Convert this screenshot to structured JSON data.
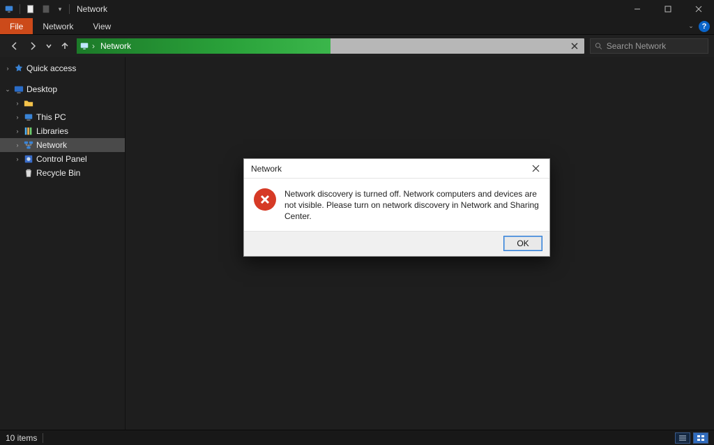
{
  "window": {
    "title": "Network"
  },
  "ribbon": {
    "file": "File",
    "tabs": [
      "Network",
      "View"
    ],
    "help": "?"
  },
  "nav": {
    "breadcrumb": "Network",
    "search_placeholder": "Search Network"
  },
  "sidebar": {
    "quick_access": "Quick access",
    "desktop": "Desktop",
    "items": [
      {
        "label": "",
        "icon": "user-folder"
      },
      {
        "label": "This PC",
        "icon": "pc"
      },
      {
        "label": "Libraries",
        "icon": "libraries"
      },
      {
        "label": "Network",
        "icon": "network",
        "selected": true
      },
      {
        "label": "Control Panel",
        "icon": "control-panel"
      },
      {
        "label": "Recycle Bin",
        "icon": "recycle-bin"
      }
    ]
  },
  "dialog": {
    "title": "Network",
    "message": "Network discovery is turned off. Network computers and devices are not visible. Please turn on network discovery in Network and Sharing Center.",
    "ok": "OK"
  },
  "status": {
    "items_text": "10 items"
  }
}
